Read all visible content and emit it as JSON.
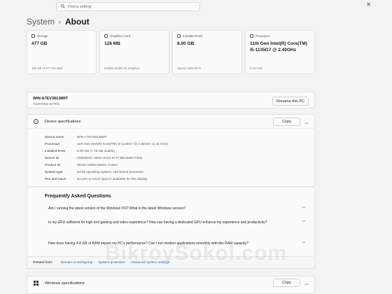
{
  "search": {
    "placeholder": "Find a setting"
  },
  "window": {
    "close_glyph": "✕"
  },
  "breadcrumb": {
    "parent": "System",
    "separator": "›",
    "current": "About"
  },
  "cards": [
    {
      "label": "Storage",
      "value": "477 GB",
      "sub": "155 GB of 477 GB used",
      "icon": "storage-icon"
    },
    {
      "label": "Graphics Card",
      "value": "128 MB",
      "sub": "Intel(R) Iris(R) Xe Graphics",
      "icon": "graphics-card-icon"
    },
    {
      "label": "Installed RAM",
      "value": "8.00 GB",
      "sub": "Speed: 3200 MT/s",
      "icon": "ram-icon"
    },
    {
      "label": "Processor",
      "value": "11th Gen Intel(R) Core(TM) i5-1135G7 @ 2.40GHz",
      "sub": "2.42 GHz",
      "icon": "processor-icon"
    }
  ],
  "device": {
    "name": "WIN-A7EV38138MT",
    "model": "TAMARIND EXTRG",
    "rename_label": "Rename this PC"
  },
  "specs": {
    "title": "Device specifications",
    "copy_label": "Copy",
    "rows": [
      {
        "label": "Device name",
        "value": "WIN-A7EV38138MT"
      },
      {
        "label": "Processor",
        "value": "11th Gen Intel(R) Core(TM) i5-1135G7 @ 2.40GHz (2.42 GHz)"
      },
      {
        "label": "Installed RAM",
        "value": "8.00 GB (7.78 GB usable)"
      },
      {
        "label": "Device ID",
        "value": "F5520D4C-2E5A-4A23-9777-B6A689C736D"
      },
      {
        "label": "Product ID",
        "value": "00331-10000-00001-AA824"
      },
      {
        "label": "System type",
        "value": "64-bit operating system, x64-based processor"
      },
      {
        "label": "Pen and touch",
        "value": "No pen or touch input is available for this display"
      }
    ]
  },
  "faq": {
    "title": "Frequently Asked Questions",
    "items": [
      "Am I running the latest version of the Windows OS? What is the latest Windows version?",
      "Is my GPU sufficient for high end gaming and video experience? How can having a dedicated GPU enhance my experience and productivity?",
      "How does having 4-8 GB of RAM impact my PC's performance? Can I run modern applications smoothly with this RAM capacity?"
    ]
  },
  "related": {
    "label": "Related links",
    "links": [
      "Domain or workgroup",
      "System protection",
      "Advanced system settings"
    ]
  },
  "windows_specs": {
    "title": "Windows specifications",
    "copy_label": "Copy"
  },
  "watermark": "BikroySokol.com"
}
